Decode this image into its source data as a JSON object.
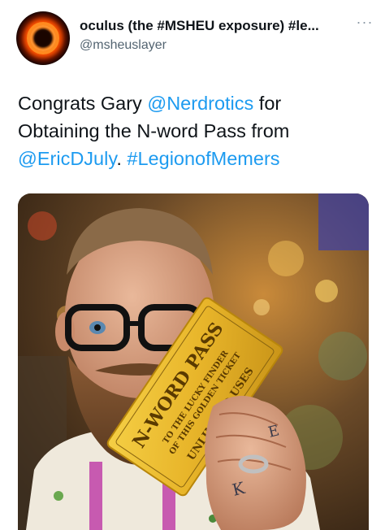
{
  "tweet": {
    "display_name": "oculus (the #MSHEU exposure) #le...",
    "handle": "@msheuslayer",
    "more_icon": "more-horizontal-icon",
    "text": {
      "line1_prefix": "Congrats Gary ",
      "mention1": "@Nerdrotics",
      "line1_suffix": "  for",
      "line2": "Obtaining the N-word Pass from",
      "mention2": "@EricDJuly",
      "separator": ". ",
      "hashtag": "#LegionofMemers"
    },
    "media": {
      "ticket_title": "N-WORD PASS",
      "ticket_line2": "TO THE LUCKY FINDER",
      "ticket_line3": "OF THIS GOLDEN TICKET",
      "ticket_footer": "UNLIMITED USES",
      "tattoo_1": "K",
      "tattoo_2": "E"
    }
  },
  "colors": {
    "link": "#1d9bf0",
    "text": "#0f1419",
    "secondary": "#536471",
    "ticket_gold": "#e8b52a"
  }
}
